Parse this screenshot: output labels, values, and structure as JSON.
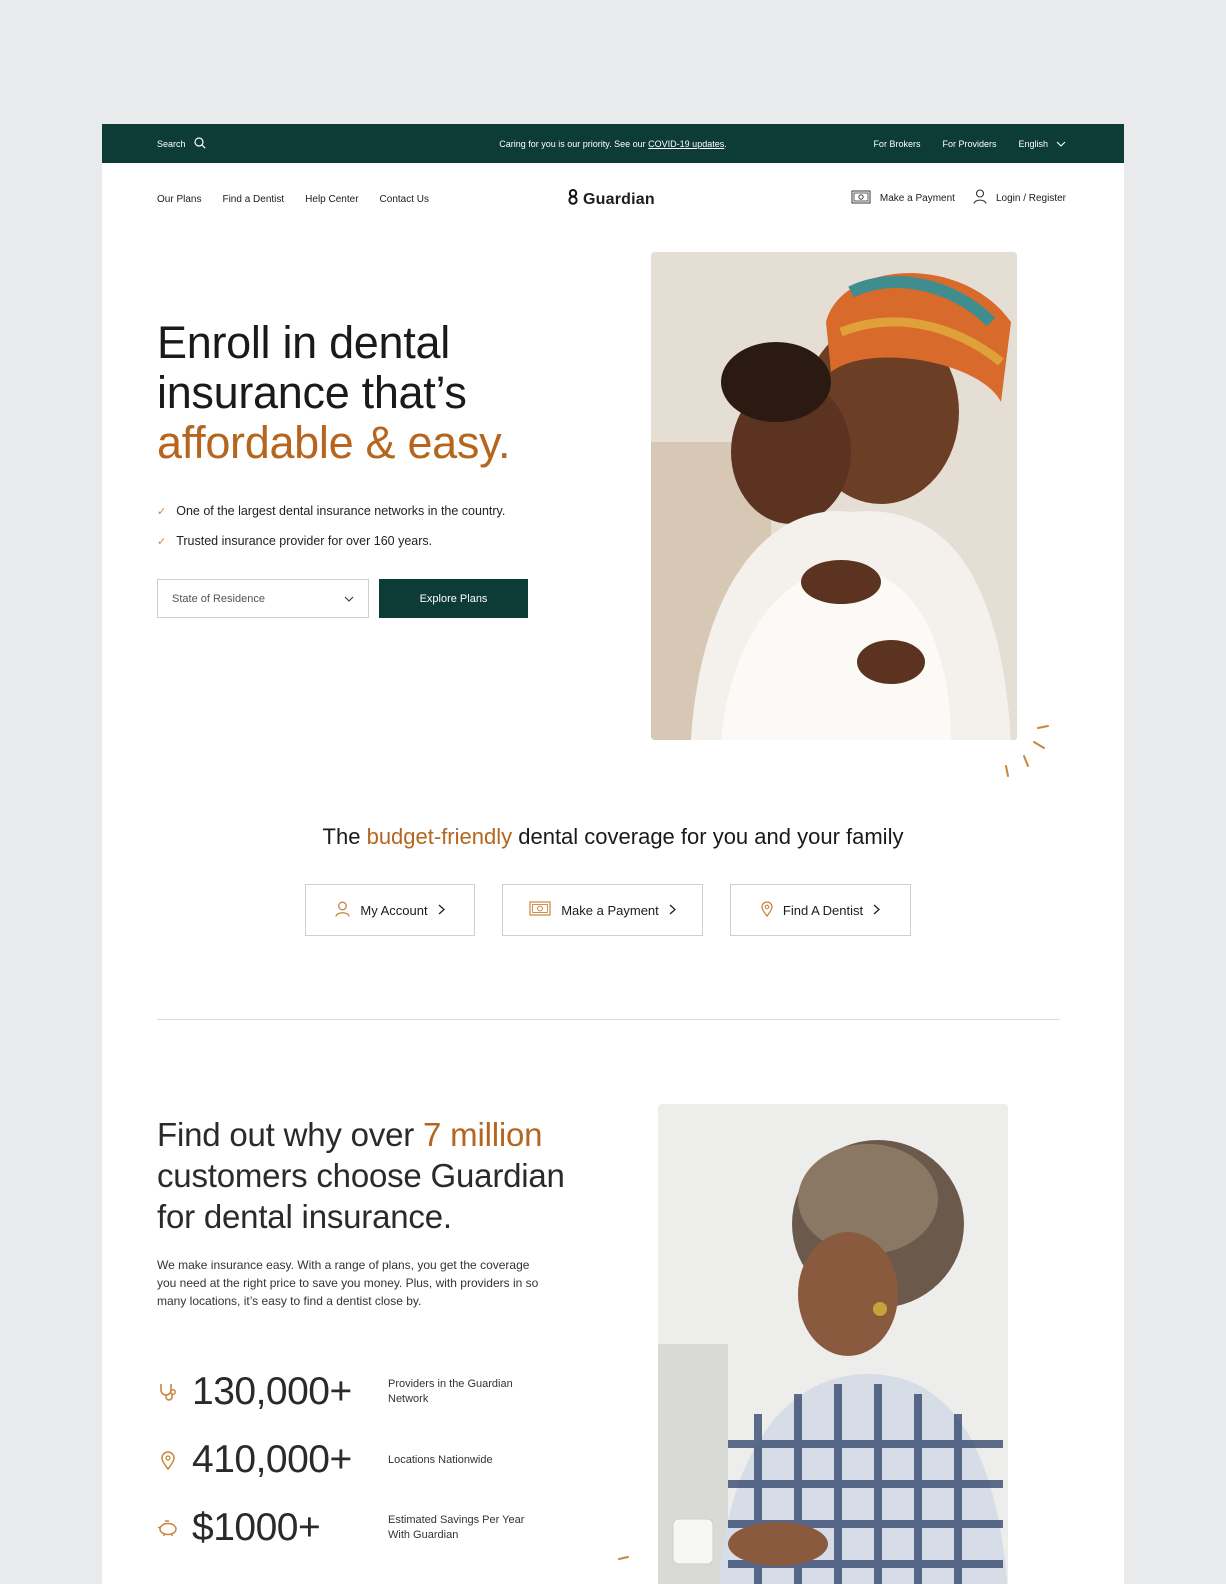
{
  "topbar": {
    "search_label": "Search",
    "notice_text": "Caring for you is our priority. See our ",
    "notice_link": "COVID-19 updates",
    "notice_end": ".",
    "for_brokers": "For Brokers",
    "for_providers": "For Providers",
    "language": "English"
  },
  "nav": {
    "links": [
      "Our Plans",
      "Find a Dentist",
      "Help Center",
      "Contact Us"
    ],
    "logo_text": "Guardian",
    "make_payment": "Make a Payment",
    "login": "Login / Register"
  },
  "hero": {
    "title_line1": "Enroll in dental",
    "title_line2": "insurance that’s",
    "title_accent": "affordable & easy.",
    "bullets": [
      "One of the largest dental insurance networks in the country.",
      "Trusted insurance provider for over 160 years."
    ],
    "state_placeholder": "State of Residence",
    "explore_button": "Explore Plans"
  },
  "budget": {
    "title_pre": "The ",
    "title_accent": "budget-friendly",
    "title_post": " dental coverage for you and your family",
    "buttons": [
      "My Account",
      "Make a Payment",
      "Find A Dentist"
    ]
  },
  "why": {
    "title_pre": "Find out why over ",
    "title_accent": "7 million",
    "title_line2": "customers choose Guardian",
    "title_line3": "for dental insurance.",
    "body": "We make insurance easy. With a range of plans, you get the coverage you need at the right price to save you money. Plus, with providers in so many locations, it’s easy to find a dentist close by.",
    "stats": [
      {
        "value": "130,000+",
        "label": "Providers in the Guardian Network",
        "icon": "stethoscope-icon"
      },
      {
        "value": "410,000+",
        "label": "Locations Nationwide",
        "icon": "location-pin-icon"
      },
      {
        "value": "$1000+",
        "label": "Estimated Savings Per Year With Guardian",
        "icon": "piggy-bank-icon"
      }
    ]
  },
  "colors": {
    "brand_green": "#0d3b35",
    "accent_orange": "#b5651d"
  }
}
